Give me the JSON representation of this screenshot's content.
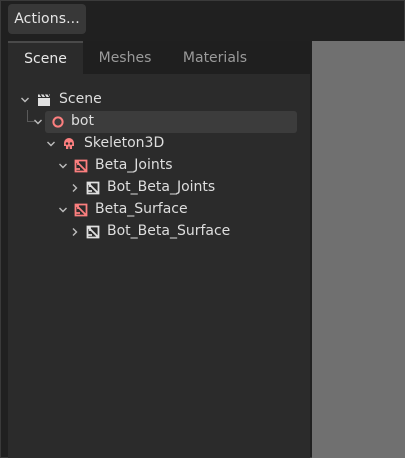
{
  "toolbar": {
    "actions_label": "Actions..."
  },
  "tabs": [
    {
      "label": "Scene",
      "active": true
    },
    {
      "label": "Meshes",
      "active": false
    },
    {
      "label": "Materials",
      "active": false
    }
  ],
  "tree": [
    {
      "label": "Scene",
      "icon": "clapperboard-icon",
      "expanded": true,
      "selected": false
    },
    {
      "label": "bot",
      "icon": "circle-outline-icon",
      "expanded": true,
      "selected": true
    },
    {
      "label": "Skeleton3D",
      "icon": "skull-icon",
      "expanded": true,
      "selected": false
    },
    {
      "label": "Beta_Joints",
      "icon": "mesh-instance-icon",
      "expanded": true,
      "selected": false
    },
    {
      "label": "Bot_Beta_Joints",
      "icon": "mesh-icon",
      "expanded": false,
      "selected": false
    },
    {
      "label": "Beta_Surface",
      "icon": "mesh-instance-icon",
      "expanded": true,
      "selected": false
    },
    {
      "label": "Bot_Beta_Surface",
      "icon": "mesh-icon",
      "expanded": false,
      "selected": false
    }
  ],
  "colors": {
    "accent_red": "#fc7f7f",
    "panel_bg": "#2b2b2b",
    "viewport_bg": "#707070"
  }
}
